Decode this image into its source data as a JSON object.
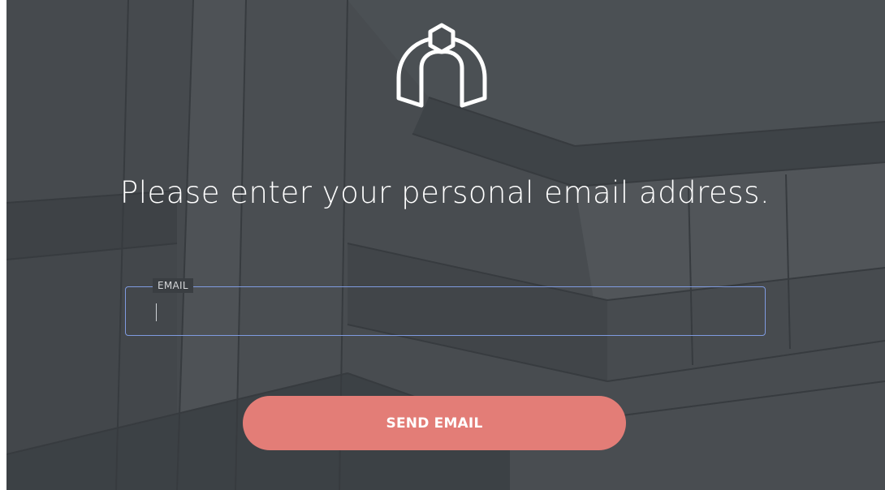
{
  "page": {
    "heading": "Please enter your personal email address."
  },
  "email": {
    "label": "EMAIL",
    "value": "",
    "placeholder": ""
  },
  "actions": {
    "send_label": "SEND EMAIL"
  },
  "icons": {
    "logo": "building-logo-icon"
  },
  "colors": {
    "button": "#e37d77",
    "field_border": "#7f9be0",
    "text": "#ffffff"
  }
}
